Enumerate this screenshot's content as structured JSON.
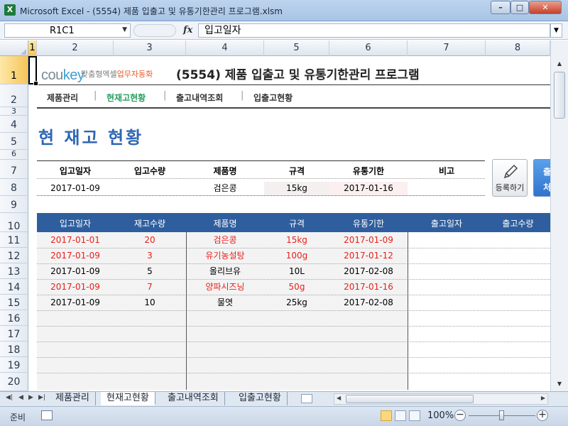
{
  "window": {
    "title": "Microsoft Excel - (5554) 제품 입출고 및 유통기한관리 프로그램.xlsm",
    "app_icon": "X",
    "min": "–",
    "max": "□",
    "close": "✕"
  },
  "formula_bar": {
    "name_box": "R1C1",
    "fx": "fx",
    "content": "입고일자"
  },
  "columns": [
    "1",
    "2",
    "3",
    "4",
    "5",
    "6",
    "7",
    "8"
  ],
  "rows": [
    "1",
    "2",
    "3",
    "4",
    "5",
    "6",
    "7",
    "8",
    "9",
    "10",
    "11",
    "12",
    "13",
    "14",
    "15",
    "16",
    "17",
    "18",
    "19",
    "20"
  ],
  "header": {
    "logo_brand_a": "cou",
    "logo_brand_b": "key",
    "logo_tagline_a": "맞춤형엑셀",
    "logo_tagline_b": "업무자동화",
    "title": "(5554) 제품 입출고 및 유통기한관리 프로그램"
  },
  "nav": [
    "제품관리",
    "현재고현황",
    "출고내역조회",
    "입출고현황"
  ],
  "nav_separator": "|",
  "section_title": "현 재고 현황",
  "input_form": {
    "headers": [
      "입고일자",
      "입고수량",
      "제품명",
      "규격",
      "유통기한",
      "비고"
    ],
    "values": {
      "date": "2017-01-09",
      "qty": "",
      "product": "검은콩",
      "spec": "15kg",
      "expiry": "2017-01-16",
      "note": ""
    }
  },
  "buttons": {
    "register": "등록하기",
    "outbound_line1": "출",
    "outbound_line2": "처"
  },
  "table": {
    "headers": [
      "입고일자",
      "재고수량",
      "제품명",
      "규격",
      "유통기한",
      "출고일자",
      "출고수량"
    ],
    "rows": [
      {
        "date": "2017-01-01",
        "stock": "20",
        "product": "검은콩",
        "spec": "15kg",
        "expiry": "2017-01-09",
        "warn": true
      },
      {
        "date": "2017-01-09",
        "stock": "3",
        "product": "유기농설탕",
        "spec": "100g",
        "expiry": "2017-01-12",
        "warn": true
      },
      {
        "date": "2017-01-09",
        "stock": "5",
        "product": "올리브유",
        "spec": "10L",
        "expiry": "2017-02-08",
        "warn": false
      },
      {
        "date": "2017-01-09",
        "stock": "7",
        "product": "양파시즈닝",
        "spec": "50g",
        "expiry": "2017-01-16",
        "warn": true
      },
      {
        "date": "2017-01-09",
        "stock": "10",
        "product": "물엿",
        "spec": "25kg",
        "expiry": "2017-02-08",
        "warn": false
      }
    ]
  },
  "sheet_tabs": [
    "제품관리",
    "현재고현황",
    "출고내역조회",
    "입출고현황"
  ],
  "active_sheet": "현재고현황",
  "status": {
    "ready": "준비",
    "zoom": "100%",
    "zoom_minus": "−",
    "zoom_plus": "+"
  },
  "colors": {
    "accent_blue": "#2e66b3",
    "table_header": "#2f5e9e",
    "warn_red": "#e8201a",
    "nav_active": "#28a060"
  }
}
